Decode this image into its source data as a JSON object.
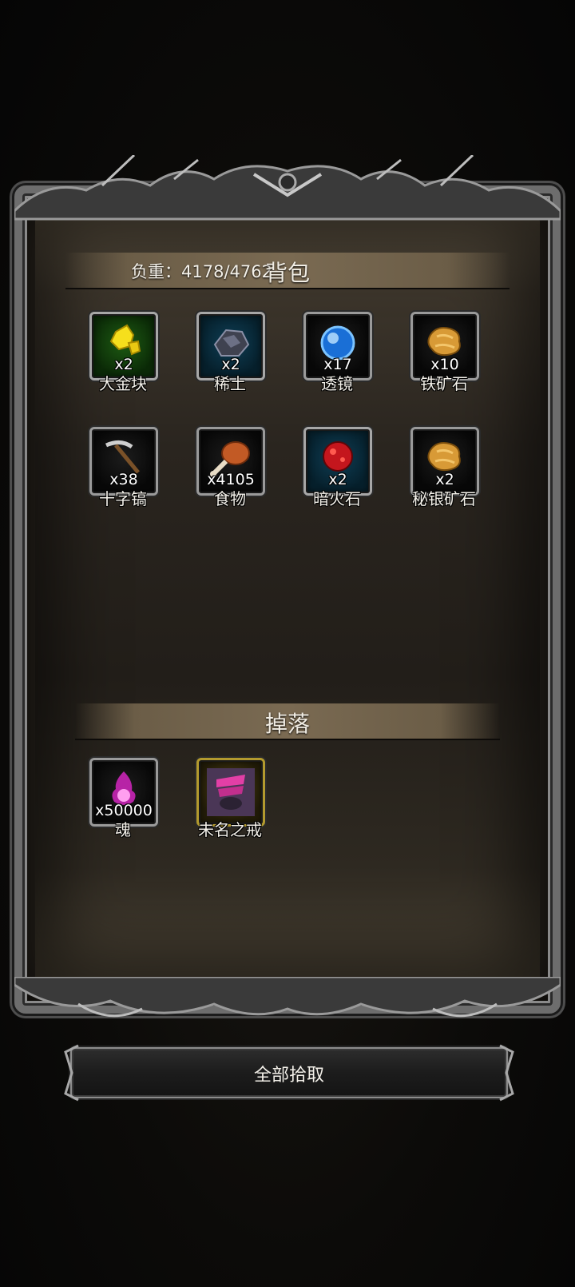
{
  "backpack": {
    "title": "背包",
    "weight": "负重：4178/4762",
    "items": [
      {
        "name": "大金块",
        "count": "x2",
        "icon": "gold-nugget-icon",
        "frame": "green"
      },
      {
        "name": "稀土",
        "count": "x2",
        "icon": "rare-earth-ore-icon",
        "frame": "blue"
      },
      {
        "name": "透镜",
        "count": "x17",
        "icon": "lens-orb-icon",
        "frame": "plain"
      },
      {
        "name": "铁矿石",
        "count": "x10",
        "icon": "iron-ore-icon",
        "frame": "plain"
      },
      {
        "name": "十字镐",
        "count": "x38",
        "icon": "pickaxe-icon",
        "frame": "plain"
      },
      {
        "name": "食物",
        "count": "x4105",
        "icon": "meat-drumstick-icon",
        "frame": "plain"
      },
      {
        "name": "暗火石",
        "count": "x2",
        "icon": "dark-fire-stone-icon",
        "frame": "blue"
      },
      {
        "name": "秘银矿石",
        "count": "x2",
        "icon": "mithril-ore-icon",
        "frame": "plain"
      }
    ]
  },
  "drops": {
    "title": "掉落",
    "items": [
      {
        "name": "魂",
        "count": "x50000",
        "icon": "soul-flame-icon",
        "frame": "plain"
      },
      {
        "name": "未名之戒",
        "count": "",
        "icon": "unnamed-ring-icon",
        "frame": "gold"
      }
    ]
  },
  "actions": {
    "pickup_all": "全部拾取"
  },
  "colors": {
    "text": "#f4f1ea",
    "section_bar": "#7a6a52",
    "frame_metal": "#8a8a8a",
    "rare_frame": "#b39a2e"
  }
}
